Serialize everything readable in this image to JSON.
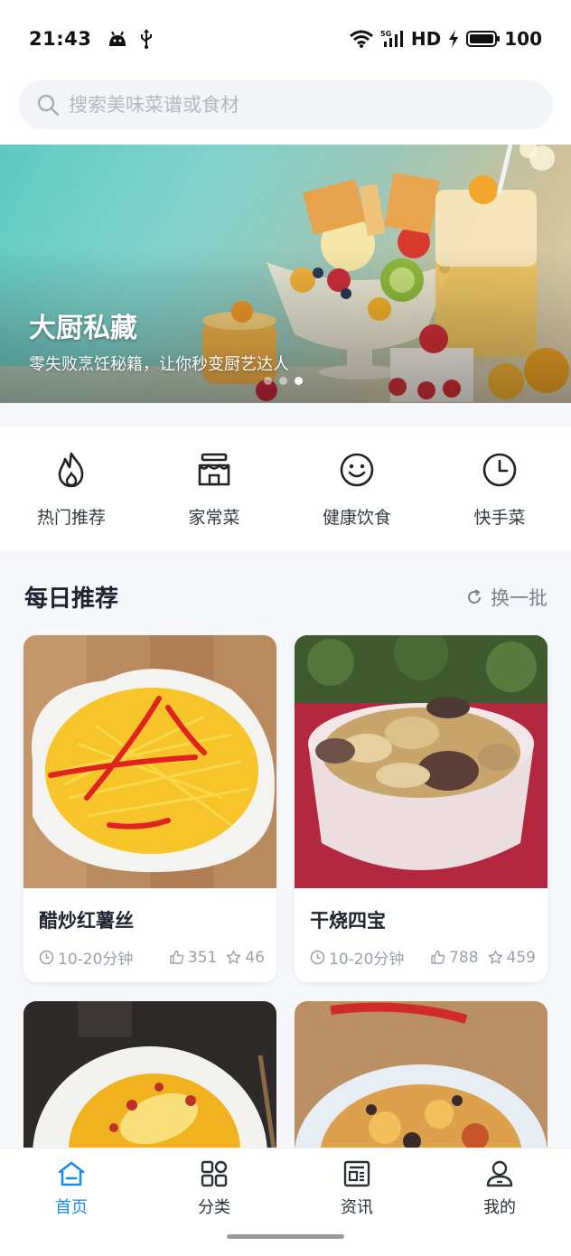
{
  "status_bar": {
    "time": "21:43",
    "network": "5G",
    "hd": "HD",
    "battery": "100",
    "icons": [
      "android-icon",
      "usb-icon",
      "wifi-icon",
      "signal-icon",
      "charging-icon",
      "battery-icon"
    ]
  },
  "search": {
    "placeholder": "搜索美味菜谱或食材"
  },
  "banner": {
    "title": "大厨私藏",
    "subtitle": "零失败烹饪秘籍，让你秒变厨艺达人",
    "total_slides": 3,
    "active_slide": 3
  },
  "categories": [
    {
      "label": "热门推荐",
      "icon": "flame-icon"
    },
    {
      "label": "家常菜",
      "icon": "shop-icon"
    },
    {
      "label": "健康饮食",
      "icon": "smile-icon"
    },
    {
      "label": "快手菜",
      "icon": "clock-icon"
    }
  ],
  "daily": {
    "title": "每日推荐",
    "refresh_label": "换一批",
    "recipes": [
      {
        "name": "醋炒红薯丝",
        "time": "10-20分钟",
        "likes": "351",
        "favorites": "46"
      },
      {
        "name": "干烧四宝",
        "time": "10-20分钟",
        "likes": "788",
        "favorites": "459"
      }
    ]
  },
  "bottom_nav": [
    {
      "label": "首页",
      "icon": "home-icon",
      "active": true
    },
    {
      "label": "分类",
      "icon": "grid-icon",
      "active": false
    },
    {
      "label": "资讯",
      "icon": "news-icon",
      "active": false
    },
    {
      "label": "我的",
      "icon": "user-icon",
      "active": false
    }
  ],
  "colors": {
    "accent": "#1e88e5",
    "page_bg": "#f5f7fa",
    "text_primary": "#1f2430",
    "text_secondary": "#9aa0ab"
  }
}
